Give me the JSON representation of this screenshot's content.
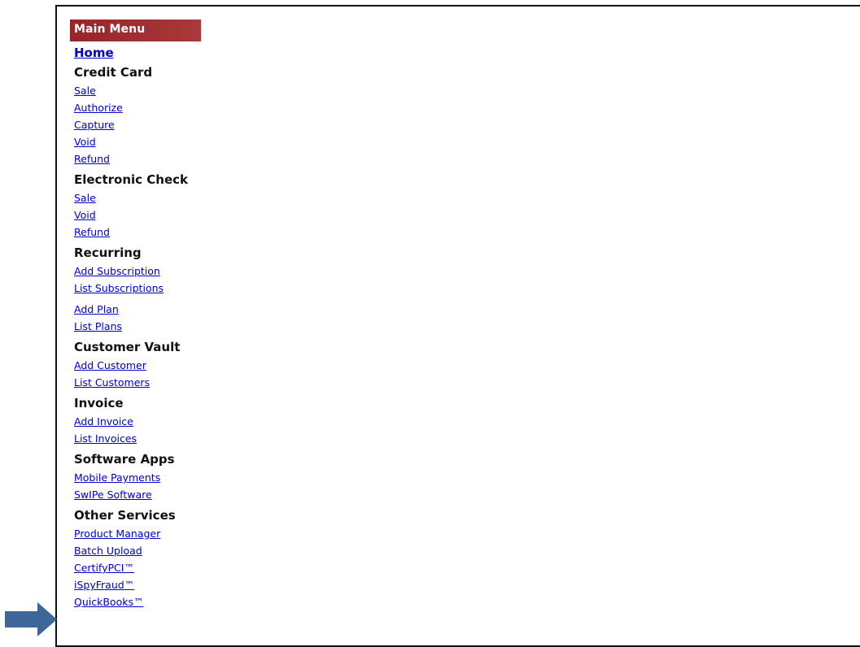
{
  "menu": {
    "header": "Main Menu",
    "home": "Home",
    "sections": [
      {
        "title": "Credit Card",
        "links": [
          "Sale",
          "Authorize",
          "Capture",
          "Void",
          "Refund"
        ]
      },
      {
        "title": "Electronic Check",
        "links": [
          "Sale",
          "Void",
          "Refund"
        ]
      },
      {
        "title": "Recurring",
        "links": [
          "Add Subscription",
          "List Subscriptions",
          "Add Plan",
          "List Plans"
        ]
      },
      {
        "title": "Customer Vault",
        "links": [
          "Add Customer",
          "List Customers"
        ]
      },
      {
        "title": "Invoice",
        "links": [
          "Add Invoice",
          "List Invoices"
        ]
      },
      {
        "title": "Software Apps",
        "links": [
          "Mobile Payments",
          "SwIPe Software"
        ]
      },
      {
        "title": "Other Services",
        "links": [
          "Product Manager",
          "Batch Upload",
          "CertifyPCI™",
          "iSpyFraud™",
          "QuickBooks™"
        ]
      }
    ]
  },
  "colors": {
    "header_bg": "#9e2a2e",
    "link": "#0000cc",
    "arrow": "#3d6796"
  },
  "icons": {
    "pointer": "right-arrow-icon"
  }
}
